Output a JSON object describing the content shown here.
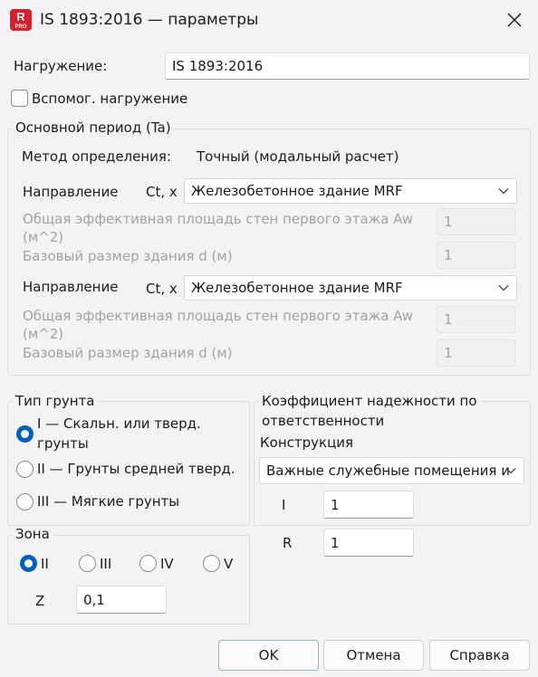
{
  "window": {
    "title": "IS 1893:2016 — параметры",
    "icon_letter": "R",
    "icon_badge": "PRO",
    "icon": "close-icon"
  },
  "load": {
    "label": "Нагружение:",
    "value": "IS 1893:2016",
    "aux_label": "Вспомог. нагружение",
    "aux_checked": false
  },
  "period": {
    "legend": "Основной период (Ta)",
    "method_label": "Метод определения:",
    "method_value": "Точный (модальный расчет)",
    "directions": [
      {
        "label": "Направление",
        "axis": "Ct, x",
        "building_type": "Железобетонное здание MRF",
        "area_label_line1": "Общая эффективная площадь стен первого этажа Aw",
        "area_label_line2": "(м^2)",
        "area_value": "1",
        "size_label": "Базовый размер здания d (м)",
        "size_value": "1"
      },
      {
        "label": "Направление",
        "axis": "Ct, x",
        "building_type": "Железобетонное здание MRF",
        "area_label_line1": "Общая эффективная площадь стен первого этажа Aw",
        "area_label_line2": "(м^2)",
        "area_value": "1",
        "size_label": "Базовый размер здания d (м)",
        "size_value": "1"
      }
    ]
  },
  "soil": {
    "legend": "Тип грунта",
    "options": [
      {
        "label_line1": "I — Скальн. или тверд.",
        "label_line2": "грунты",
        "selected": true
      },
      {
        "label": "II — Грунты средней тверд.",
        "selected": false
      },
      {
        "label": "III — Мягкие грунты",
        "selected": false
      }
    ]
  },
  "zone": {
    "legend": "Зона",
    "options": [
      {
        "label": "II",
        "selected": true
      },
      {
        "label": "III",
        "selected": false
      },
      {
        "label": "IV",
        "selected": false
      },
      {
        "label": "V",
        "selected": false
      }
    ],
    "z_label": "Z",
    "z_value": "0,1"
  },
  "importance": {
    "title_line1": "Коэффициент надежности по",
    "title_line2": "ответственности",
    "structure_label": "Конструкция",
    "structure_value": "Важные служебные помещения и",
    "i_label": "I",
    "i_value": "1",
    "r_label": "R",
    "r_value": "1"
  },
  "buttons": {
    "ok": "OK",
    "cancel": "Отмена",
    "help": "Справка"
  },
  "colors": {
    "accent": "#005fb8",
    "icon_red": "#d6202c",
    "background": "#f3f3f3"
  }
}
